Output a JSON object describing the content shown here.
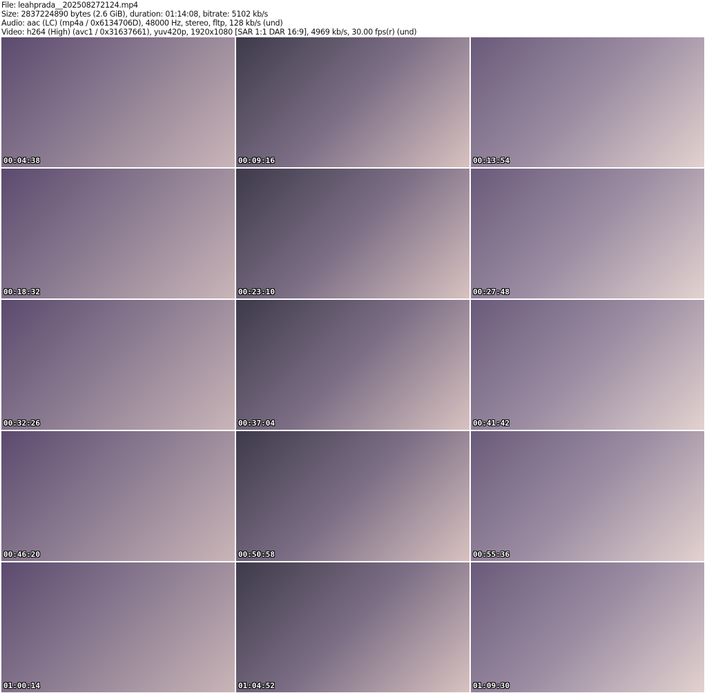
{
  "header": {
    "file": "File: leahprada__202508272124.mp4",
    "size": "Size: 2837224890 bytes (2.6 GiB), duration: 01:14:08, bitrate: 5102 kb/s",
    "audio": "Audio: aac (LC) (mp4a / 0x6134706D), 48000 Hz, stereo, fltp, 128 kb/s (und)",
    "video": "Video: h264 (High) (avc1 / 0x31637661), yuv420p, 1920x1080 [SAR 1:1 DAR 16:9], 4969 kb/s, 30.00 fps(r) (und)"
  },
  "thumbnails": [
    {
      "timestamp": "00:04:38"
    },
    {
      "timestamp": "00:09:16"
    },
    {
      "timestamp": "00:13:54"
    },
    {
      "timestamp": "00:18:32"
    },
    {
      "timestamp": "00:23:10"
    },
    {
      "timestamp": "00:27:48"
    },
    {
      "timestamp": "00:32:26"
    },
    {
      "timestamp": "00:37:04"
    },
    {
      "timestamp": "00:41:42"
    },
    {
      "timestamp": "00:46:20"
    },
    {
      "timestamp": "00:50:58"
    },
    {
      "timestamp": "00:55:36"
    },
    {
      "timestamp": "01:00:14"
    },
    {
      "timestamp": "01:04:52"
    },
    {
      "timestamp": "01:09:30"
    }
  ]
}
